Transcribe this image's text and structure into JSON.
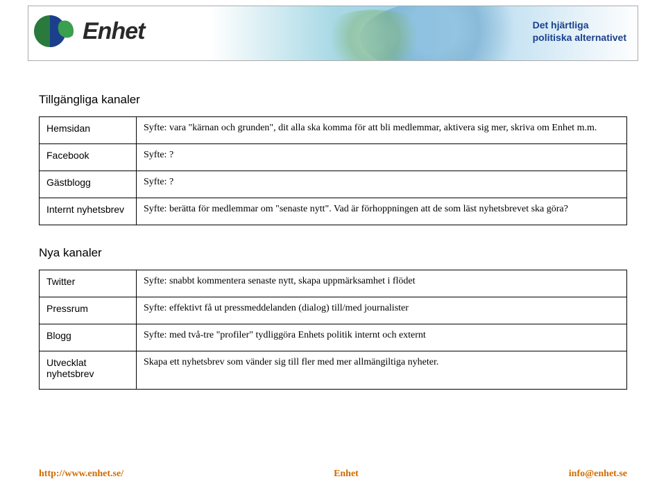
{
  "banner": {
    "brand": "Enhet",
    "tagline_line1": "Det hjärtliga",
    "tagline_line2": "politiska alternativet"
  },
  "section1": {
    "title": "Tillgängliga kanaler",
    "rows": [
      {
        "label": "Hemsidan",
        "desc": "Syfte: vara \"kärnan och grunden\", dit alla ska komma för att bli medlemmar, aktivera sig mer, skriva om Enhet m.m."
      },
      {
        "label": "Facebook",
        "desc": "Syfte: ?"
      },
      {
        "label": "Gästblogg",
        "desc": "Syfte: ?"
      },
      {
        "label": "Internt nyhetsbrev",
        "desc": "Syfte: berätta för medlemmar om \"senaste nytt\". Vad är förhoppningen att de som läst nyhetsbrevet ska göra?"
      }
    ]
  },
  "section2": {
    "title": "Nya kanaler",
    "rows": [
      {
        "label": "Twitter",
        "desc": "Syfte: snabbt kommentera senaste nytt, skapa uppmärksamhet i flödet"
      },
      {
        "label": "Pressrum",
        "desc": "Syfte: effektivt få ut pressmeddelanden (dialog) till/med journalister"
      },
      {
        "label": "Blogg",
        "desc": "Syfte: med två-tre \"profiler\" tydliggöra Enhets politik internt och externt"
      },
      {
        "label": "Utvecklat nyhetsbrev",
        "desc": "Skapa ett nyhetsbrev som vänder sig till fler med mer allmängiltiga nyheter."
      }
    ]
  },
  "footer": {
    "url": "http://www.enhet.se/",
    "org": "Enhet",
    "email": "info@enhet.se"
  }
}
